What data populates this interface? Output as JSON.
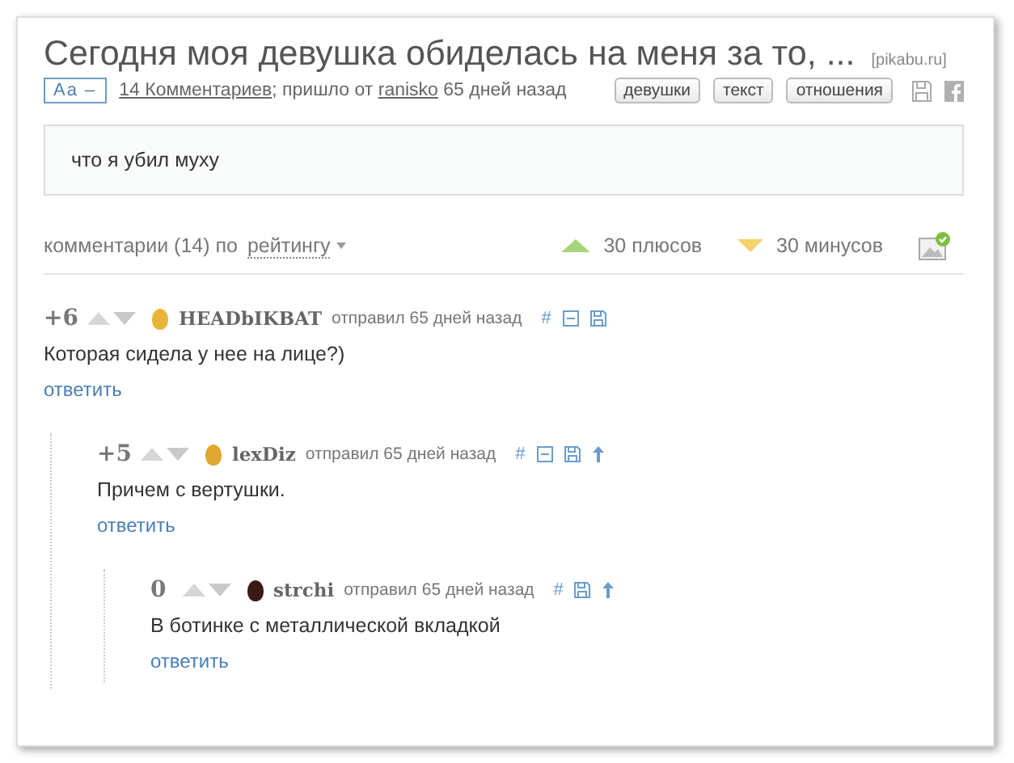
{
  "post": {
    "title": "Сегодня моя девушка обиделась на меня за то, ...",
    "source": "[pikabu.ru]",
    "font_toggle": "Aa –",
    "comments_link": "14 Комментариев",
    "from_text": "; пришло от",
    "author": "ranisko",
    "age": "65 дней назад",
    "tags": [
      "девушки",
      "текст",
      "отношения"
    ],
    "body": "что я убил муху"
  },
  "sort_bar": {
    "label": "комментарии (14) по",
    "sort": "рейтингу",
    "plus": "30 плюсов",
    "minus": "30 минусов"
  },
  "comments": [
    {
      "score": "+6",
      "author": "HEADbIKBAT",
      "color": "#e8b53a",
      "posted": "отправил 65 дней назад",
      "tools": [
        {
          "kind": "hash",
          "label": "#"
        },
        {
          "kind": "collapse"
        },
        {
          "kind": "save"
        }
      ],
      "text": "Которая сидела у нее на лице?)",
      "reply": "ответить",
      "children": [
        {
          "score": "+5",
          "author": "lexDiz",
          "color": "#e0a830",
          "posted": "отправил 65 дней назад",
          "tools": [
            {
              "kind": "hash",
              "label": "#"
            },
            {
              "kind": "collapse"
            },
            {
              "kind": "save"
            },
            {
              "kind": "up"
            }
          ],
          "text": "Причем с вертушки.",
          "reply": "ответить",
          "children": [
            {
              "score": "0",
              "author": "strchi",
              "color": "#3a1a14",
              "posted": "отправил 65 дней назад",
              "tools": [
                {
                  "kind": "hash",
                  "label": "#"
                },
                {
                  "kind": "save"
                },
                {
                  "kind": "up"
                }
              ],
              "text": "В ботинке с металлической вкладкой",
              "reply": "ответить"
            }
          ]
        }
      ]
    }
  ]
}
